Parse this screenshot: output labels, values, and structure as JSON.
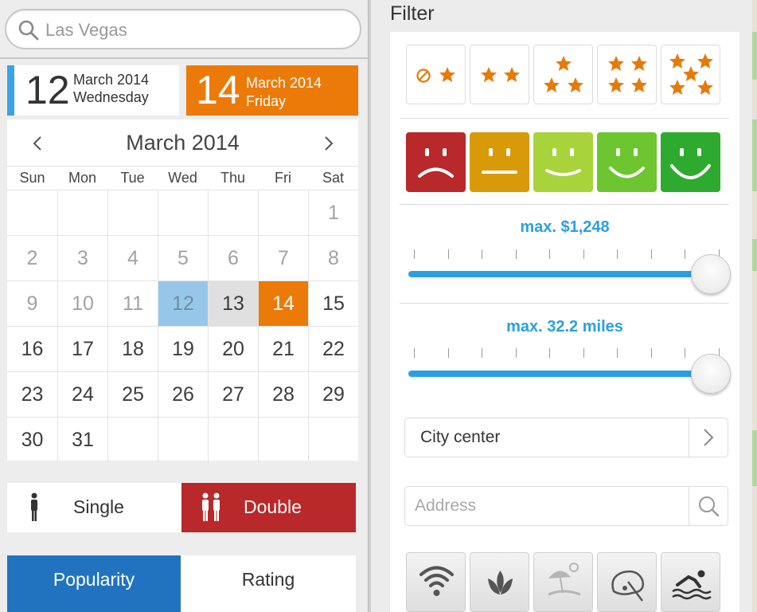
{
  "search": {
    "placeholder": "Las Vegas"
  },
  "date_range": {
    "start": {
      "day": "12",
      "month_year": "March 2014",
      "weekday": "Wednesday"
    },
    "end": {
      "day": "14",
      "month_year": "March 2014",
      "weekday": "Friday"
    }
  },
  "calendar": {
    "title": "March 2014",
    "weekdays": [
      "Sun",
      "Mon",
      "Tue",
      "Wed",
      "Thu",
      "Fri",
      "Sat"
    ],
    "rows": [
      [
        "",
        "",
        "",
        "",
        "",
        "",
        "1"
      ],
      [
        "2",
        "3",
        "4",
        "5",
        "6",
        "7",
        "8"
      ],
      [
        "9",
        "10",
        "11",
        "12",
        "13",
        "14",
        "15"
      ],
      [
        "16",
        "17",
        "18",
        "19",
        "20",
        "21",
        "22"
      ],
      [
        "23",
        "24",
        "25",
        "26",
        "27",
        "28",
        "29"
      ],
      [
        "30",
        "31",
        "",
        "",
        "",
        "",
        ""
      ]
    ],
    "selected_start": "12",
    "selected_middle": "13",
    "selected_end": "14",
    "disabled_through": "11"
  },
  "room": {
    "single": "Single",
    "double": "Double",
    "selected": "Double"
  },
  "sort": {
    "popularity": "Popularity",
    "rating": "Rating",
    "selected": "Popularity"
  },
  "filter": {
    "title": "Filter",
    "price_label": "max. $1,248",
    "distance_label": "max. 32.2 miles",
    "price_fraction": 1.0,
    "distance_fraction": 1.0,
    "location": "City center",
    "address_placeholder": "Address",
    "star_options": [
      "no-star",
      "2-stars",
      "3-stars",
      "4-stars",
      "5-stars"
    ],
    "rating_faces": [
      {
        "name": "very-sad-face-icon",
        "color": "#b9282a"
      },
      {
        "name": "neutral-face-icon",
        "color": "#d89a09"
      },
      {
        "name": "slight-smile-face-icon",
        "color": "#a9d33b"
      },
      {
        "name": "smile-face-icon",
        "color": "#6dc62f"
      },
      {
        "name": "big-smile-face-icon",
        "color": "#2eab2e"
      }
    ],
    "amenities": [
      "wifi-icon",
      "spa-icon",
      "beach-icon",
      "golf-icon",
      "pool-icon"
    ]
  },
  "colors": {
    "accent_blue": "#2aa0e1",
    "orange": "#ec7a08",
    "red": "#b9282a",
    "sort_blue": "#2173bf"
  }
}
